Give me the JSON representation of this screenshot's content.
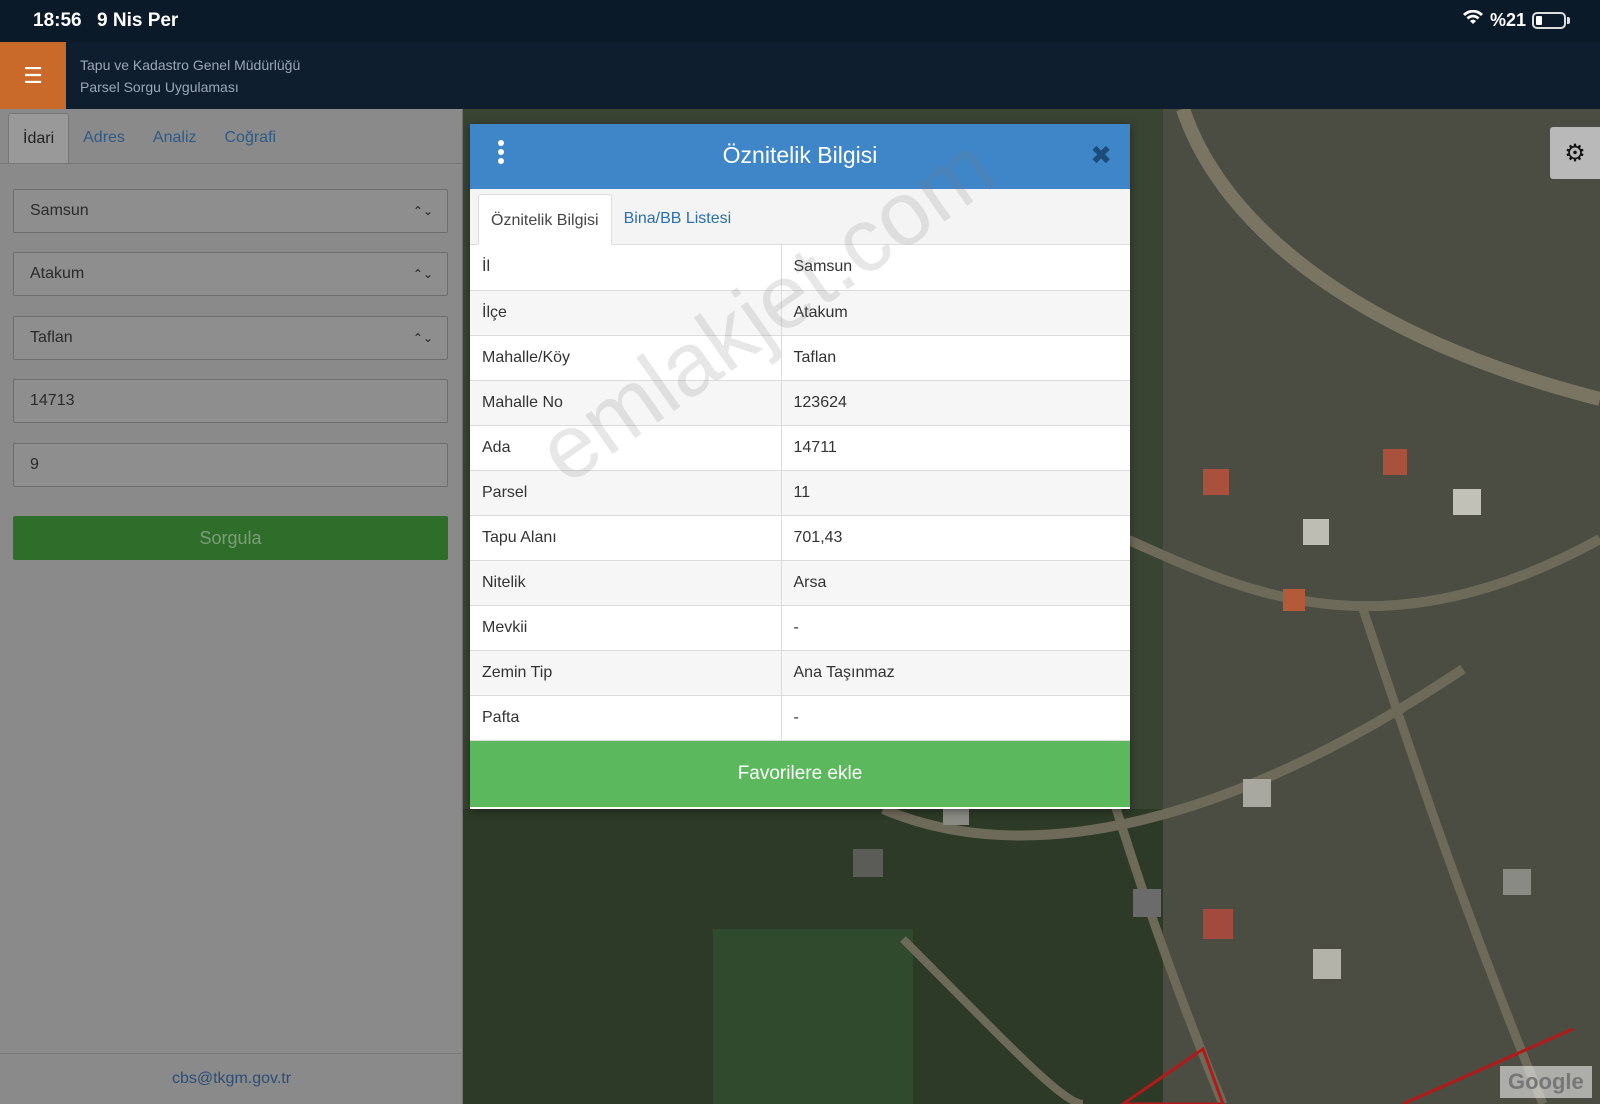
{
  "status": {
    "time": "18:56",
    "date": "9 Nis Per",
    "battery": "%21"
  },
  "header": {
    "title_line1": "Tapu ve Kadastro Genel Müdürlüğü",
    "title_line2": "Parsel Sorgu Uygulaması"
  },
  "sidebar": {
    "tabs": [
      "İdari",
      "Adres",
      "Analiz",
      "Coğrafi"
    ],
    "active_tab": "İdari",
    "fields": {
      "il": "Samsun",
      "ilce": "Atakum",
      "mahalle": "Taflan",
      "ada": "14713",
      "parsel": "9"
    },
    "submit_label": "Sorgula",
    "footer_email": "cbs@tkgm.gov.tr"
  },
  "modal": {
    "title": "Öznitelik Bilgisi",
    "tabs": [
      "Öznitelik Bilgisi",
      "Bina/BB Listesi"
    ],
    "rows": [
      {
        "key": "İl",
        "value": "Samsun"
      },
      {
        "key": "İlçe",
        "value": "Atakum"
      },
      {
        "key": "Mahalle/Köy",
        "value": "Taflan"
      },
      {
        "key": "Mahalle No",
        "value": "123624"
      },
      {
        "key": "Ada",
        "value": "14711"
      },
      {
        "key": "Parsel",
        "value": "11"
      },
      {
        "key": "Tapu Alanı",
        "value": "701,43"
      },
      {
        "key": "Nitelik",
        "value": "Arsa"
      },
      {
        "key": "Mevkii",
        "value": "-"
      },
      {
        "key": "Zemin Tip",
        "value": "Ana Taşınmaz"
      },
      {
        "key": "Pafta",
        "value": "-"
      }
    ],
    "favorite_label": "Favorilere ekle"
  },
  "map": {
    "logo": "Google"
  },
  "watermark": "emlakjet.com",
  "colors": {
    "header_blue": "#3f86c8",
    "favorite_green": "#5cb85c",
    "menu_orange": "#c9692a"
  }
}
